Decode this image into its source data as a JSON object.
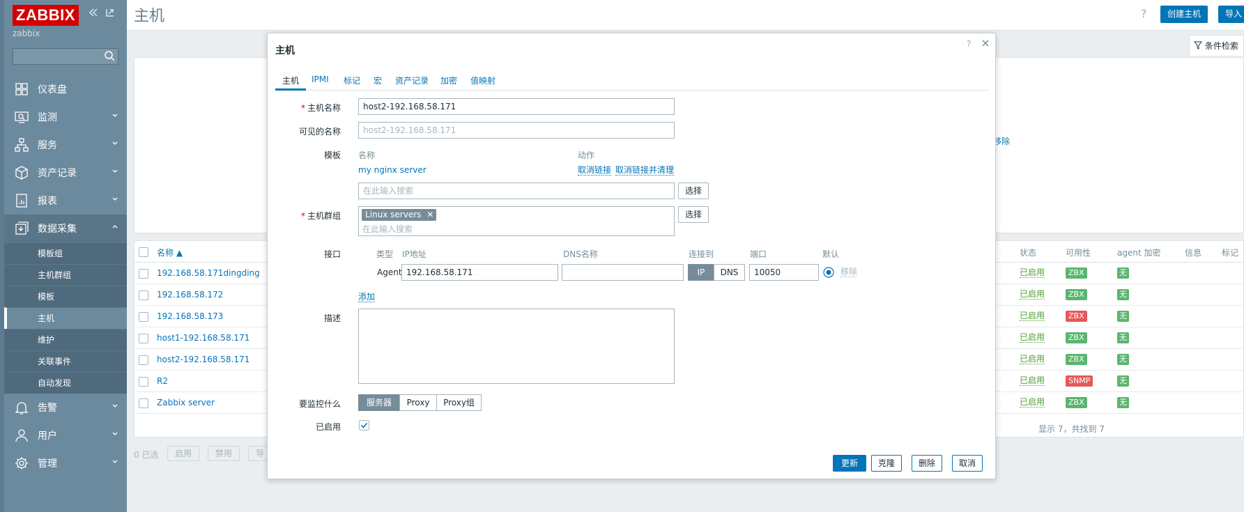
{
  "sidebar": {
    "logo": "ZABBIX",
    "server_name": "zabbix",
    "search_placeholder": "",
    "items": [
      {
        "label": "仪表盘"
      },
      {
        "label": "监测"
      },
      {
        "label": "服务"
      },
      {
        "label": "资产记录"
      },
      {
        "label": "报表"
      },
      {
        "label": "数据采集"
      },
      {
        "label": "告警"
      },
      {
        "label": "用户"
      },
      {
        "label": "管理"
      }
    ],
    "subitems": [
      {
        "label": "模板组"
      },
      {
        "label": "主机群组"
      },
      {
        "label": "模板"
      },
      {
        "label": "主机"
      },
      {
        "label": "维护"
      },
      {
        "label": "关联事件"
      },
      {
        "label": "自动发现"
      }
    ]
  },
  "header": {
    "title": "主机",
    "help": "?",
    "create_button": "创建主机",
    "import_button": "导入"
  },
  "filter": {
    "tab_label": "条件检索",
    "remove_partial": "移除"
  },
  "table": {
    "columns": {
      "name": "名称 ▲",
      "status": "状态",
      "availability": "可用性",
      "agent_encryption": "agent 加密",
      "info": "信息",
      "tags": "标记"
    },
    "rows": [
      {
        "name": "192.168.58.171dingding",
        "status": "已启用",
        "availability": "ZBX",
        "avail_color": "#5bb56f",
        "encryption": "无"
      },
      {
        "name": "192.168.58.172",
        "status": "已启用",
        "availability": "ZBX",
        "avail_color": "#5bb56f",
        "encryption": "无"
      },
      {
        "name": "192.168.58.173",
        "status": "已启用",
        "availability": "ZBX",
        "avail_color": "#e45959",
        "encryption": "无"
      },
      {
        "name": "host1-192.168.58.171",
        "status": "已启用",
        "availability": "ZBX",
        "avail_color": "#5bb56f",
        "encryption": "无"
      },
      {
        "name": "host2-192.168.58.171",
        "status": "已启用",
        "availability": "ZBX",
        "avail_color": "#5bb56f",
        "encryption": "无"
      },
      {
        "name": "R2",
        "status": "已启用",
        "availability": "SNMP",
        "avail_color": "#e45959",
        "encryption": "无"
      },
      {
        "name": "Zabbix server",
        "status": "已启用",
        "availability": "ZBX",
        "avail_color": "#5bb56f",
        "encryption": "无"
      }
    ],
    "footer": "显示 7，共找到 7",
    "selected_count": "0 已选",
    "bulk": {
      "enable": "启用",
      "disable": "禁用",
      "export_partial": "导"
    }
  },
  "modal": {
    "title": "主机",
    "help": "?",
    "tabs": [
      "主机",
      "IPMI",
      "标记",
      "宏",
      "资产记录",
      "加密",
      "值映射"
    ],
    "host_name_label": "主机名称",
    "host_name_value": "host2-192.168.58.171",
    "visible_name_label": "可见的名称",
    "visible_name_placeholder": "host2-192.168.58.171",
    "templates_label": "模板",
    "templates_col_name": "名称",
    "templates_col_action": "动作",
    "template_name": "my nginx server",
    "unlink": "取消链接",
    "unlink_clear": "取消链接并清理",
    "template_search_placeholder": "在此输入搜索",
    "select_button": "选择",
    "groups_label": "主机群组",
    "group_tag": "Linux servers",
    "group_search_placeholder": "在此输入搜索",
    "interfaces_label": "接口",
    "iface_cols": {
      "type": "类型",
      "ip": "IP地址",
      "dns": "DNS名称",
      "connect": "连接到",
      "port": "端口",
      "default": "默认"
    },
    "iface": {
      "type": "Agent",
      "ip": "192.168.58.171",
      "dns": "",
      "conn_ip": "IP",
      "conn_dns": "DNS",
      "port": "10050",
      "remove": "移除"
    },
    "add_link": "添加",
    "description_label": "描述",
    "description_value": "",
    "monitored_by_label": "要监控什么",
    "monitored_by_options": [
      "服务器",
      "Proxy",
      "Proxy组"
    ],
    "enabled_label": "已启用",
    "buttons": {
      "update": "更新",
      "clone": "克隆",
      "delete": "删除",
      "cancel": "取消"
    }
  }
}
